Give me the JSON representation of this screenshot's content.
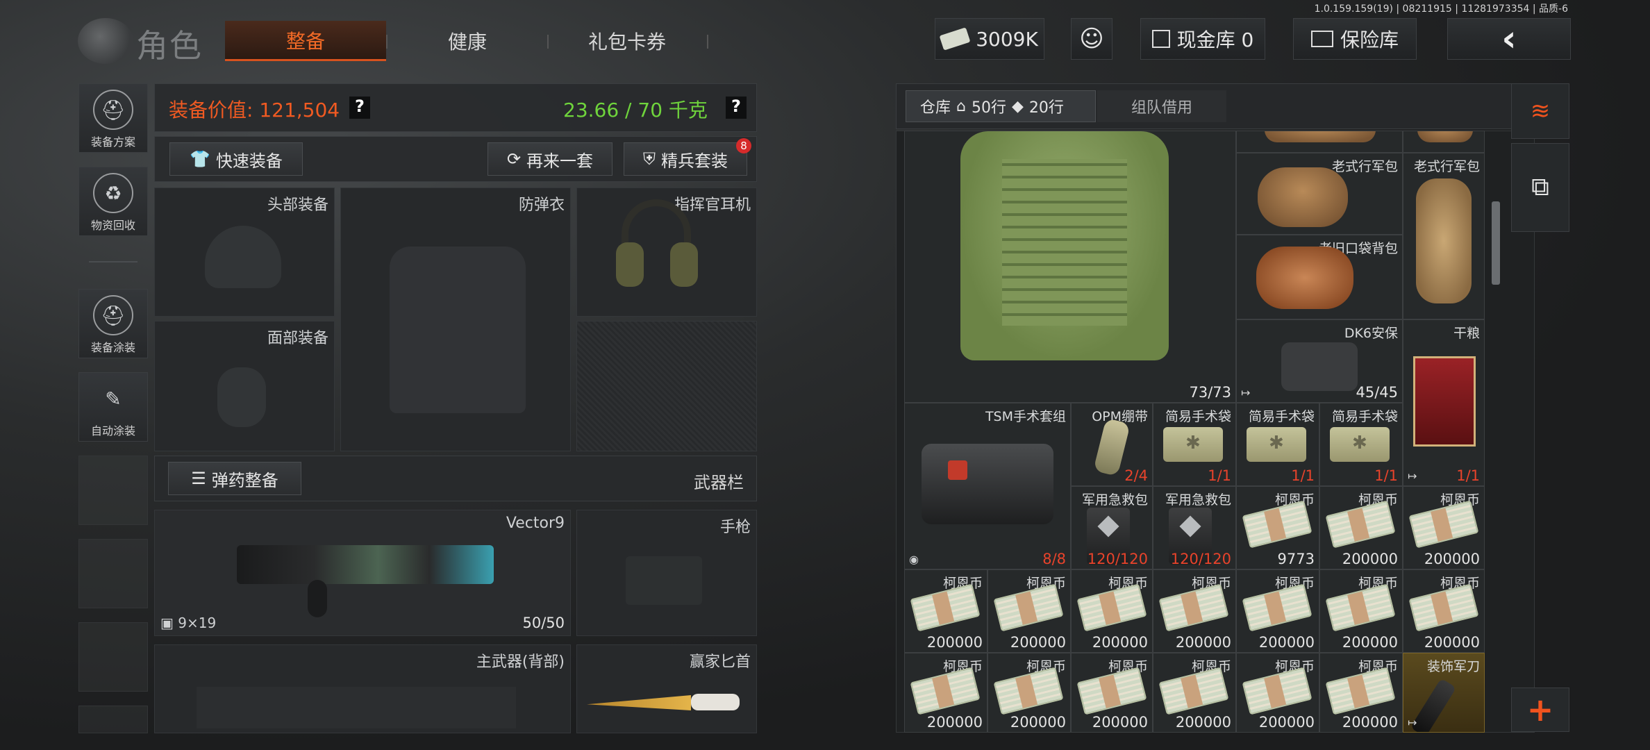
{
  "version": "1.0.159.159(19) | 08211915 | 11281973354 | 品质-6",
  "header": {
    "title": "角色",
    "tabs": [
      {
        "label": "整备",
        "active": true
      },
      {
        "label": "健康",
        "active": false
      },
      {
        "label": "礼包卡券",
        "active": false
      }
    ],
    "currency": "3009K",
    "cash_vault": "现金库 0",
    "safe": "保险库"
  },
  "sidebar": {
    "items": [
      {
        "label": "装备方案",
        "icon": "helmet-grid-icon"
      },
      {
        "label": "物资回收",
        "icon": "recycle-icon"
      },
      {
        "label": "装备涂装",
        "icon": "helmet-paint-icon"
      },
      {
        "label": "自动涂装",
        "icon": "brush-gear-icon"
      }
    ]
  },
  "loadout": {
    "value_label": "装备价值: 121,504",
    "weight_label": "23.66 / 70 千克",
    "help": "?",
    "quick_equip": "快速装备",
    "again": "再来一套",
    "elite": "精兵套装",
    "elite_badge": "8",
    "slots": {
      "head": "头部装备",
      "armor": "防弹衣",
      "headset": "指挥官耳机",
      "face": "面部装备"
    },
    "ammo_button": "弹药整备",
    "weapon_bar": "武器栏",
    "primary": {
      "name": "Vector9",
      "caliber": "9×19",
      "ammo": "50/50"
    },
    "pistol": "手枪",
    "back_weapon": "主武器(背部)",
    "knife": "赢家匕首"
  },
  "stash": {
    "tabs": {
      "warehouse": "仓库",
      "rows1": "50行",
      "rows2": "20行",
      "team": "组队借用"
    },
    "armor_count": "73/73",
    "bags": [
      {
        "name": "老式行军包"
      },
      {
        "name": "老式行军包"
      },
      {
        "name": "老旧口袋背包"
      }
    ],
    "dk6": {
      "name": "DK6安保",
      "count": "45/45"
    },
    "ration": {
      "name": "干粮",
      "count": "1/1"
    },
    "tsm": {
      "name": "TSM手术套组",
      "count": "8/8"
    },
    "opm": {
      "name": "OPM绷带",
      "count": "2/4"
    },
    "pouch_name": "简易手术袋",
    "pouch_count": "1/1",
    "firstaid_name": "军用急救包",
    "firstaid_count": "120/120",
    "coin_name": "柯恩币",
    "coin_9773": "9773",
    "coin_full": "200000",
    "knife_name": "装饰军刀"
  }
}
